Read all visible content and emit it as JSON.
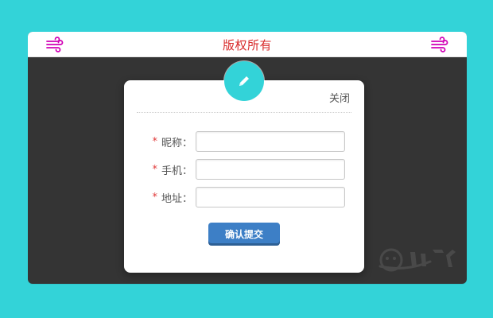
{
  "header": {
    "title": "版权所有"
  },
  "modal": {
    "close_label": "关闭",
    "fields": [
      {
        "label": "昵称：",
        "value": "",
        "placeholder": ""
      },
      {
        "label": "手机：",
        "value": "",
        "placeholder": ""
      },
      {
        "label": "地址：",
        "value": "",
        "placeholder": ""
      }
    ],
    "required_mark": "*",
    "submit_label": "确认提交"
  },
  "icons": {
    "left_header_icon": "wind-icon",
    "right_header_icon": "wind-icon",
    "top_badge_icon": "pencil-icon"
  },
  "colors": {
    "page_bg": "#33d3d8",
    "card_bg": "#343434",
    "header_title": "#d82a2a",
    "badge": "#33d3d8",
    "submit": "#3d7fc6",
    "required": "#e03a3a"
  }
}
